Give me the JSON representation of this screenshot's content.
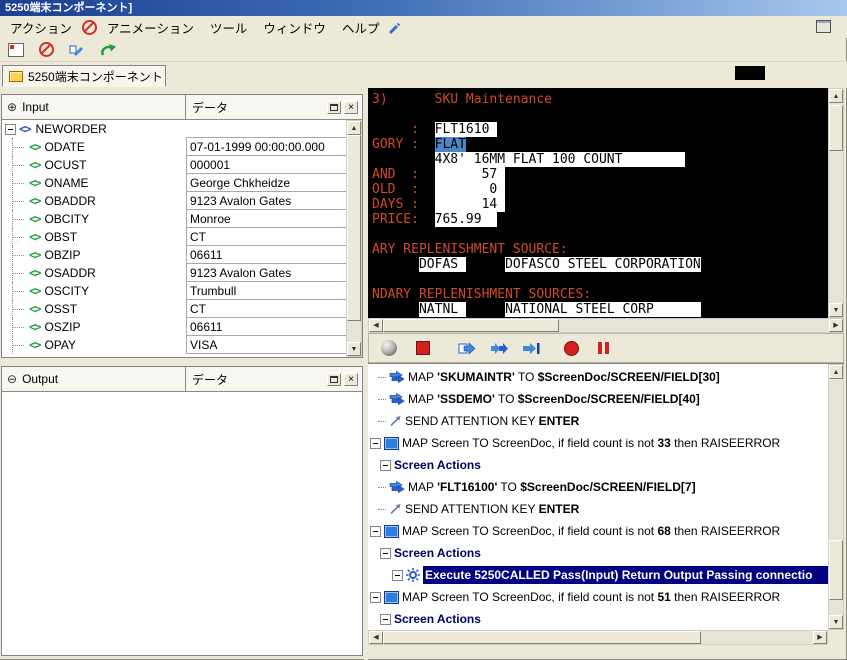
{
  "titlebar": {
    "title": "5250端末コンポーネント]"
  },
  "menubar": {
    "items": [
      "アクション",
      "アニメーション",
      "ツール",
      "ウィンドウ",
      "ヘルプ"
    ]
  },
  "tab": {
    "label": "5250端末コンポーネント"
  },
  "icons": {
    "input_badge": "⊕",
    "output_badge": "⊖",
    "close": "×",
    "scroll_up": "▲",
    "scroll_down": "▼",
    "scroll_left": "◀",
    "scroll_right": "▶"
  },
  "input_panel": {
    "title": "Input",
    "data_column_header": "データ",
    "root_node": "NEWORDER",
    "rows": [
      {
        "name": "ODATE",
        "value": "07-01-1999 00:00:00.000"
      },
      {
        "name": "OCUST",
        "value": "000001"
      },
      {
        "name": "ONAME",
        "value": "George Chkheidze"
      },
      {
        "name": "OBADDR",
        "value": "9123 Avalon Gates"
      },
      {
        "name": "OBCITY",
        "value": "Monroe"
      },
      {
        "name": "OBST",
        "value": "CT"
      },
      {
        "name": "OBZIP",
        "value": "06611"
      },
      {
        "name": "OSADDR",
        "value": "9123 Avalon Gates"
      },
      {
        "name": "OSCITY",
        "value": "Trumbull"
      },
      {
        "name": "OSST",
        "value": "CT"
      },
      {
        "name": "OSZIP",
        "value": "06611"
      },
      {
        "name": "OPAY",
        "value": "VISA"
      }
    ]
  },
  "output_panel": {
    "title": "Output",
    "data_column_header": "データ"
  },
  "terminal": {
    "colors": {
      "background": "#000000",
      "label_text": "#d14a28",
      "field_bg": "#ffffff",
      "field_text": "#000000",
      "selected_bg": "#4a86c8"
    },
    "lines": [
      [
        {
          "kind": "label",
          "text": "3)      SKU Maintenance"
        }
      ],
      [],
      [
        {
          "kind": "label",
          "text": "     :  "
        },
        {
          "kind": "field",
          "text": "FLT1610 "
        }
      ],
      [
        {
          "kind": "label",
          "text": "GORY :  "
        },
        {
          "kind": "selected",
          "text": "FLAT"
        }
      ],
      [
        {
          "kind": "label",
          "text": "        "
        },
        {
          "kind": "field",
          "text": "4X8' 16MM FLAT 100 COUNT        "
        }
      ],
      [
        {
          "kind": "label",
          "text": "AND  :  "
        },
        {
          "kind": "field",
          "text": "      57 "
        }
      ],
      [
        {
          "kind": "label",
          "text": "OLD  :  "
        },
        {
          "kind": "field",
          "text": "       0 "
        }
      ],
      [
        {
          "kind": "label",
          "text": "DAYS :  "
        },
        {
          "kind": "field",
          "text": "      14 "
        }
      ],
      [
        {
          "kind": "label",
          "text": "PRICE:  "
        },
        {
          "kind": "field",
          "text": "765.99  "
        }
      ],
      [],
      [
        {
          "kind": "label",
          "text": "ARY REPLENISHMENT SOURCE:"
        }
      ],
      [
        {
          "kind": "label",
          "text": "      "
        },
        {
          "kind": "field",
          "text": "DOFAS "
        },
        {
          "kind": "label",
          "text": "     "
        },
        {
          "kind": "field",
          "text": "DOFASCO STEEL CORPORATION"
        }
      ],
      [],
      [
        {
          "kind": "label",
          "text": "NDARY REPLENISHMENT SOURCES:"
        }
      ],
      [
        {
          "kind": "label",
          "text": "      "
        },
        {
          "kind": "field",
          "text": "NATNL "
        },
        {
          "kind": "label",
          "text": "     "
        },
        {
          "kind": "field",
          "text": "NATIONAL STEEL CORP      "
        }
      ]
    ]
  },
  "action_panel": {
    "rows": [
      {
        "kind": "deep",
        "icon": "map",
        "segments": [
          {
            "text": "MAP ",
            "bold": false
          },
          {
            "text": "'SKUMAINTR'",
            "bold": true
          },
          {
            "text": " TO ",
            "bold": false
          },
          {
            "text": "$ScreenDoc/SCREEN/FIELD[30]",
            "bold": true
          }
        ]
      },
      {
        "kind": "deep",
        "icon": "map",
        "segments": [
          {
            "text": "MAP ",
            "bold": false
          },
          {
            "text": "'SSDEMO'",
            "bold": true
          },
          {
            "text": " TO ",
            "bold": false
          },
          {
            "text": "$ScreenDoc/SCREEN/FIELD[40]",
            "bold": true
          }
        ]
      },
      {
        "kind": "deep",
        "icon": "sendkey",
        "segments": [
          {
            "text": "SEND ATTENTION KEY ",
            "bold": false
          },
          {
            "text": "ENTER",
            "bold": true
          }
        ]
      },
      {
        "kind": "screen",
        "icon": "screen",
        "segments": [
          {
            "text": "MAP Screen TO ScreenDoc, if field count is not ",
            "bold": false
          },
          {
            "text": "33",
            "bold": true
          },
          {
            "text": " then RAISEERROR",
            "bold": false
          }
        ]
      },
      {
        "kind": "group",
        "segments": [
          {
            "text": "Screen Actions",
            "bold": true
          }
        ]
      },
      {
        "kind": "deep",
        "icon": "map",
        "segments": [
          {
            "text": "MAP ",
            "bold": false
          },
          {
            "text": "'FLT16100'",
            "bold": true
          },
          {
            "text": " TO ",
            "bold": false
          },
          {
            "text": "$ScreenDoc/SCREEN/FIELD[7]",
            "bold": true
          }
        ]
      },
      {
        "kind": "deep",
        "icon": "sendkey",
        "segments": [
          {
            "text": "SEND ATTENTION KEY ",
            "bold": false
          },
          {
            "text": "ENTER",
            "bold": true
          }
        ]
      },
      {
        "kind": "screen",
        "icon": "screen",
        "segments": [
          {
            "text": "MAP Screen TO ScreenDoc, if field count is not ",
            "bold": false
          },
          {
            "text": "68",
            "bold": true
          },
          {
            "text": " then RAISEERROR",
            "bold": false
          }
        ]
      },
      {
        "kind": "group",
        "segments": [
          {
            "text": "Screen Actions",
            "bold": true
          }
        ]
      },
      {
        "kind": "execute",
        "icon": "execute",
        "selected": true,
        "segments": [
          {
            "text": "Execute 5250CALLED Pass(Input) Return Output Passing connectio",
            "bold": true
          }
        ]
      },
      {
        "kind": "screen",
        "icon": "screen",
        "segments": [
          {
            "text": "MAP Screen TO ScreenDoc, if field count is not ",
            "bold": false
          },
          {
            "text": "51",
            "bold": true
          },
          {
            "text": " then RAISEERROR",
            "bold": false
          }
        ]
      },
      {
        "kind": "group",
        "segments": [
          {
            "text": "Screen Actions",
            "bold": true
          }
        ]
      }
    ]
  }
}
